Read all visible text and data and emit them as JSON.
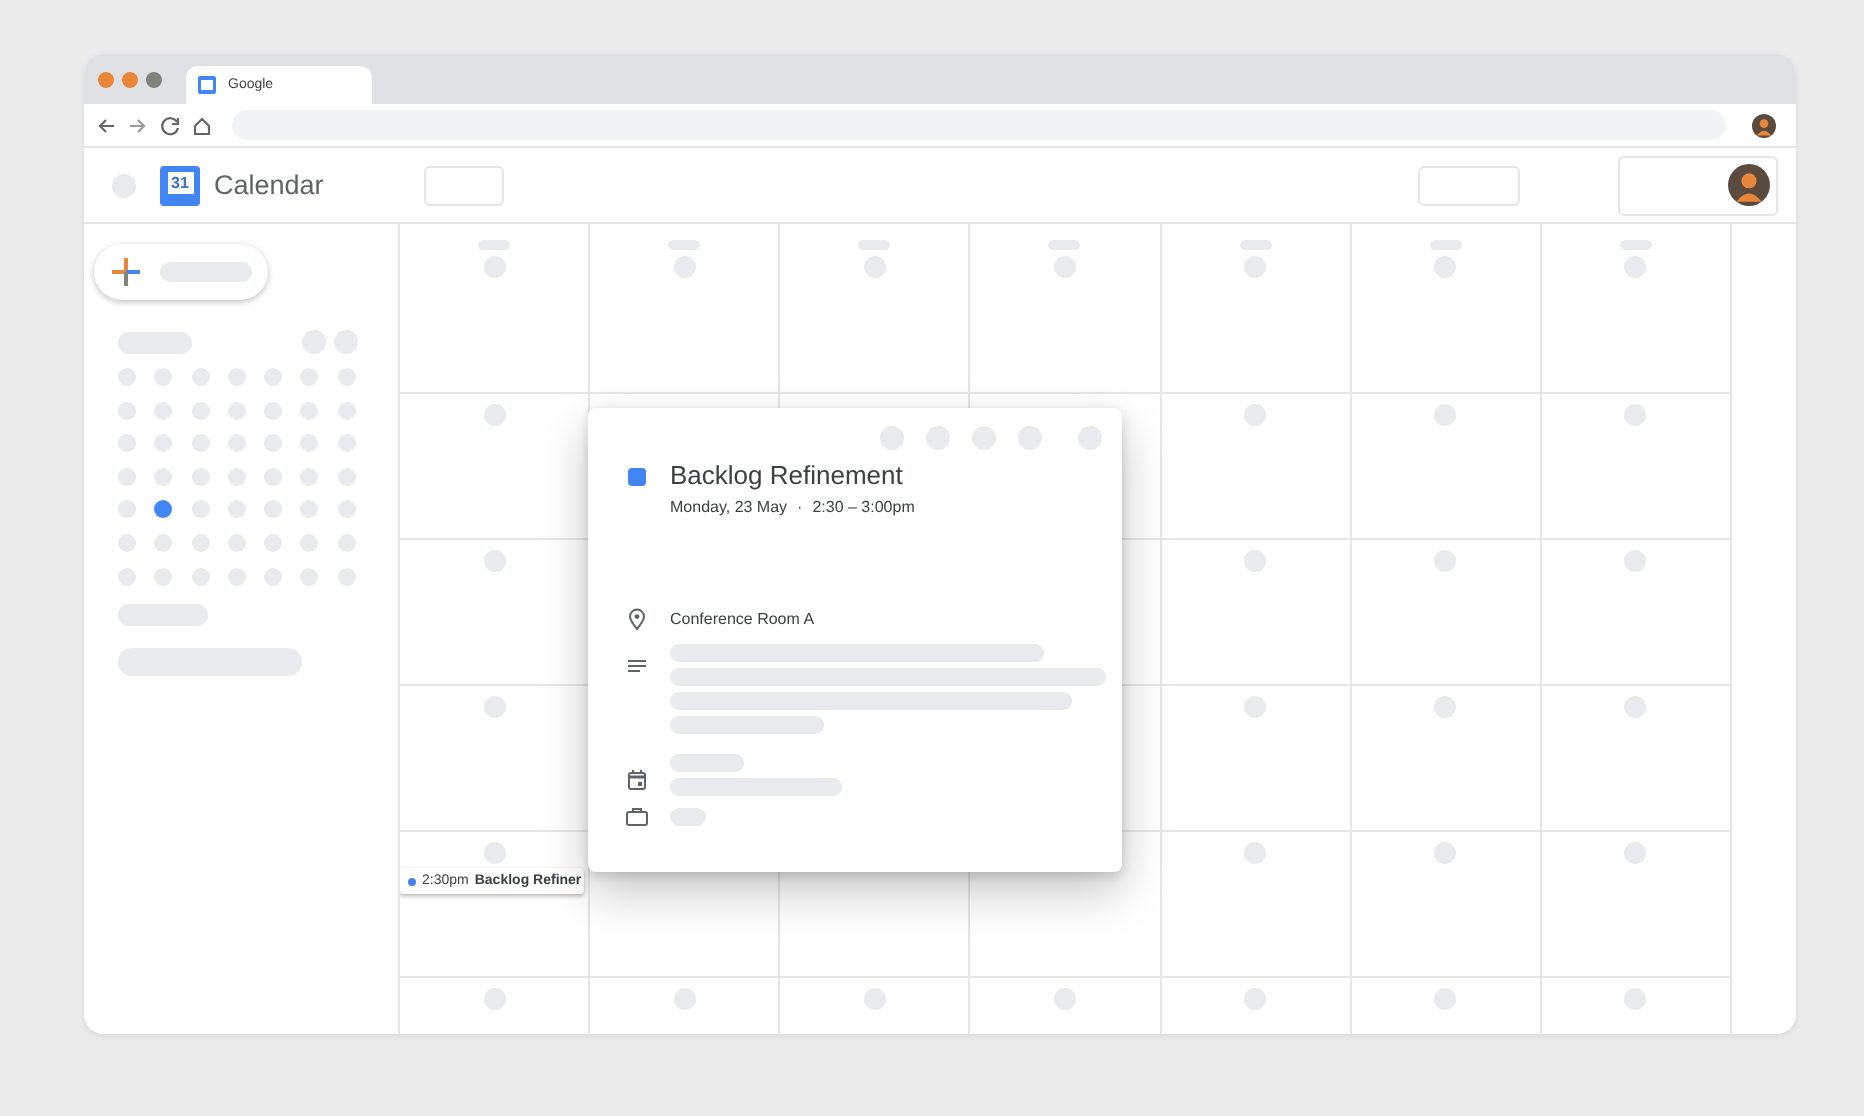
{
  "browser": {
    "tab_title": "Google"
  },
  "app": {
    "logo_text": "31",
    "title": "Calendar"
  },
  "mini_calendar": {
    "weeks": [
      {
        "days": [
          {
            "selected": false
          },
          {
            "selected": false
          },
          {
            "selected": false
          },
          {
            "selected": false
          },
          {
            "selected": false
          },
          {
            "selected": false
          },
          {
            "selected": false
          }
        ]
      },
      {
        "days": [
          {
            "selected": false
          },
          {
            "selected": false
          },
          {
            "selected": false
          },
          {
            "selected": false
          },
          {
            "selected": false
          },
          {
            "selected": false
          },
          {
            "selected": false
          }
        ]
      },
      {
        "days": [
          {
            "selected": false
          },
          {
            "selected": false
          },
          {
            "selected": false
          },
          {
            "selected": false
          },
          {
            "selected": false
          },
          {
            "selected": false
          },
          {
            "selected": false
          }
        ]
      },
      {
        "days": [
          {
            "selected": false
          },
          {
            "selected": false
          },
          {
            "selected": false
          },
          {
            "selected": false
          },
          {
            "selected": false
          },
          {
            "selected": false
          },
          {
            "selected": false
          }
        ]
      },
      {
        "days": [
          {
            "selected": false
          },
          {
            "selected": true
          },
          {
            "selected": false
          },
          {
            "selected": false
          },
          {
            "selected": false
          },
          {
            "selected": false
          },
          {
            "selected": false
          }
        ]
      },
      {
        "days": [
          {
            "selected": false
          },
          {
            "selected": false
          },
          {
            "selected": false
          },
          {
            "selected": false
          },
          {
            "selected": false
          },
          {
            "selected": false
          },
          {
            "selected": false
          }
        ]
      },
      {
        "days": [
          {
            "selected": false
          },
          {
            "selected": false
          },
          {
            "selected": false
          },
          {
            "selected": false
          },
          {
            "selected": false
          },
          {
            "selected": false
          },
          {
            "selected": false
          }
        ]
      }
    ]
  },
  "event_chip": {
    "time": "2:30pm",
    "title": "Backlog Refiner"
  },
  "event_popup": {
    "title": "Backlog Refinement",
    "date": "Monday, 23 May",
    "separator": "·",
    "time": "2:30 – 3:00pm",
    "location": "Conference Room A"
  }
}
